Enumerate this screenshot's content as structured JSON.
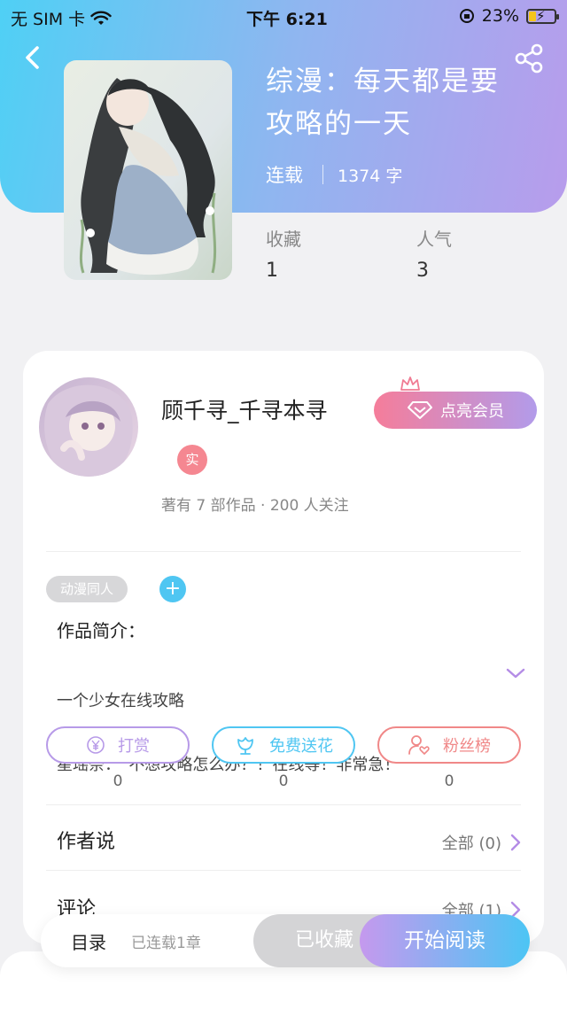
{
  "status_bar": {
    "carrier": "无 SIM 卡",
    "time": "下午 6:21",
    "battery": "23%"
  },
  "book": {
    "title_line1": "综漫：每天都是要",
    "title_line2": "攻略的一天",
    "status": "连载",
    "word_count": "1374 字",
    "stats": [
      {
        "label": "收藏",
        "value": "1"
      },
      {
        "label": "人气",
        "value": "3"
      }
    ]
  },
  "author": {
    "name": "顾千寻_千寻本寻",
    "real_badge": "实",
    "stats": "著有 7 部作品 · 200 人关注",
    "vip_button": "点亮会员"
  },
  "tags": [
    "动漫同人"
  ],
  "add_tag": "+",
  "intro": {
    "title": "作品简介：",
    "line1": "一个少女在线攻略",
    "line2": "星瑶奈：“不想攻略怎么办？！在线等！非常急！”"
  },
  "actions": [
    {
      "label": "打赏",
      "count": "0",
      "icon": "yen-icon",
      "color": "#b79ae8"
    },
    {
      "label": "免费送花",
      "count": "0",
      "icon": "flower-icon",
      "color": "#4fc6f2"
    },
    {
      "label": "粉丝榜",
      "count": "0",
      "icon": "fan-icon",
      "color": "#f08888"
    }
  ],
  "sections": {
    "author_says": {
      "title": "作者说",
      "link": "全部 (0)"
    },
    "comments": {
      "title": "评论",
      "link": "全部 (1)"
    }
  },
  "bottom": {
    "toc": "目录",
    "chapters": "已连载1章",
    "collected": "已收藏",
    "read": "开始阅读"
  },
  "colors": {
    "header_gradient_start": "#4fd0f5",
    "header_gradient_end": "#b89cec",
    "accent_purple": "#b79ae8",
    "chevron": "#b48ce6"
  }
}
